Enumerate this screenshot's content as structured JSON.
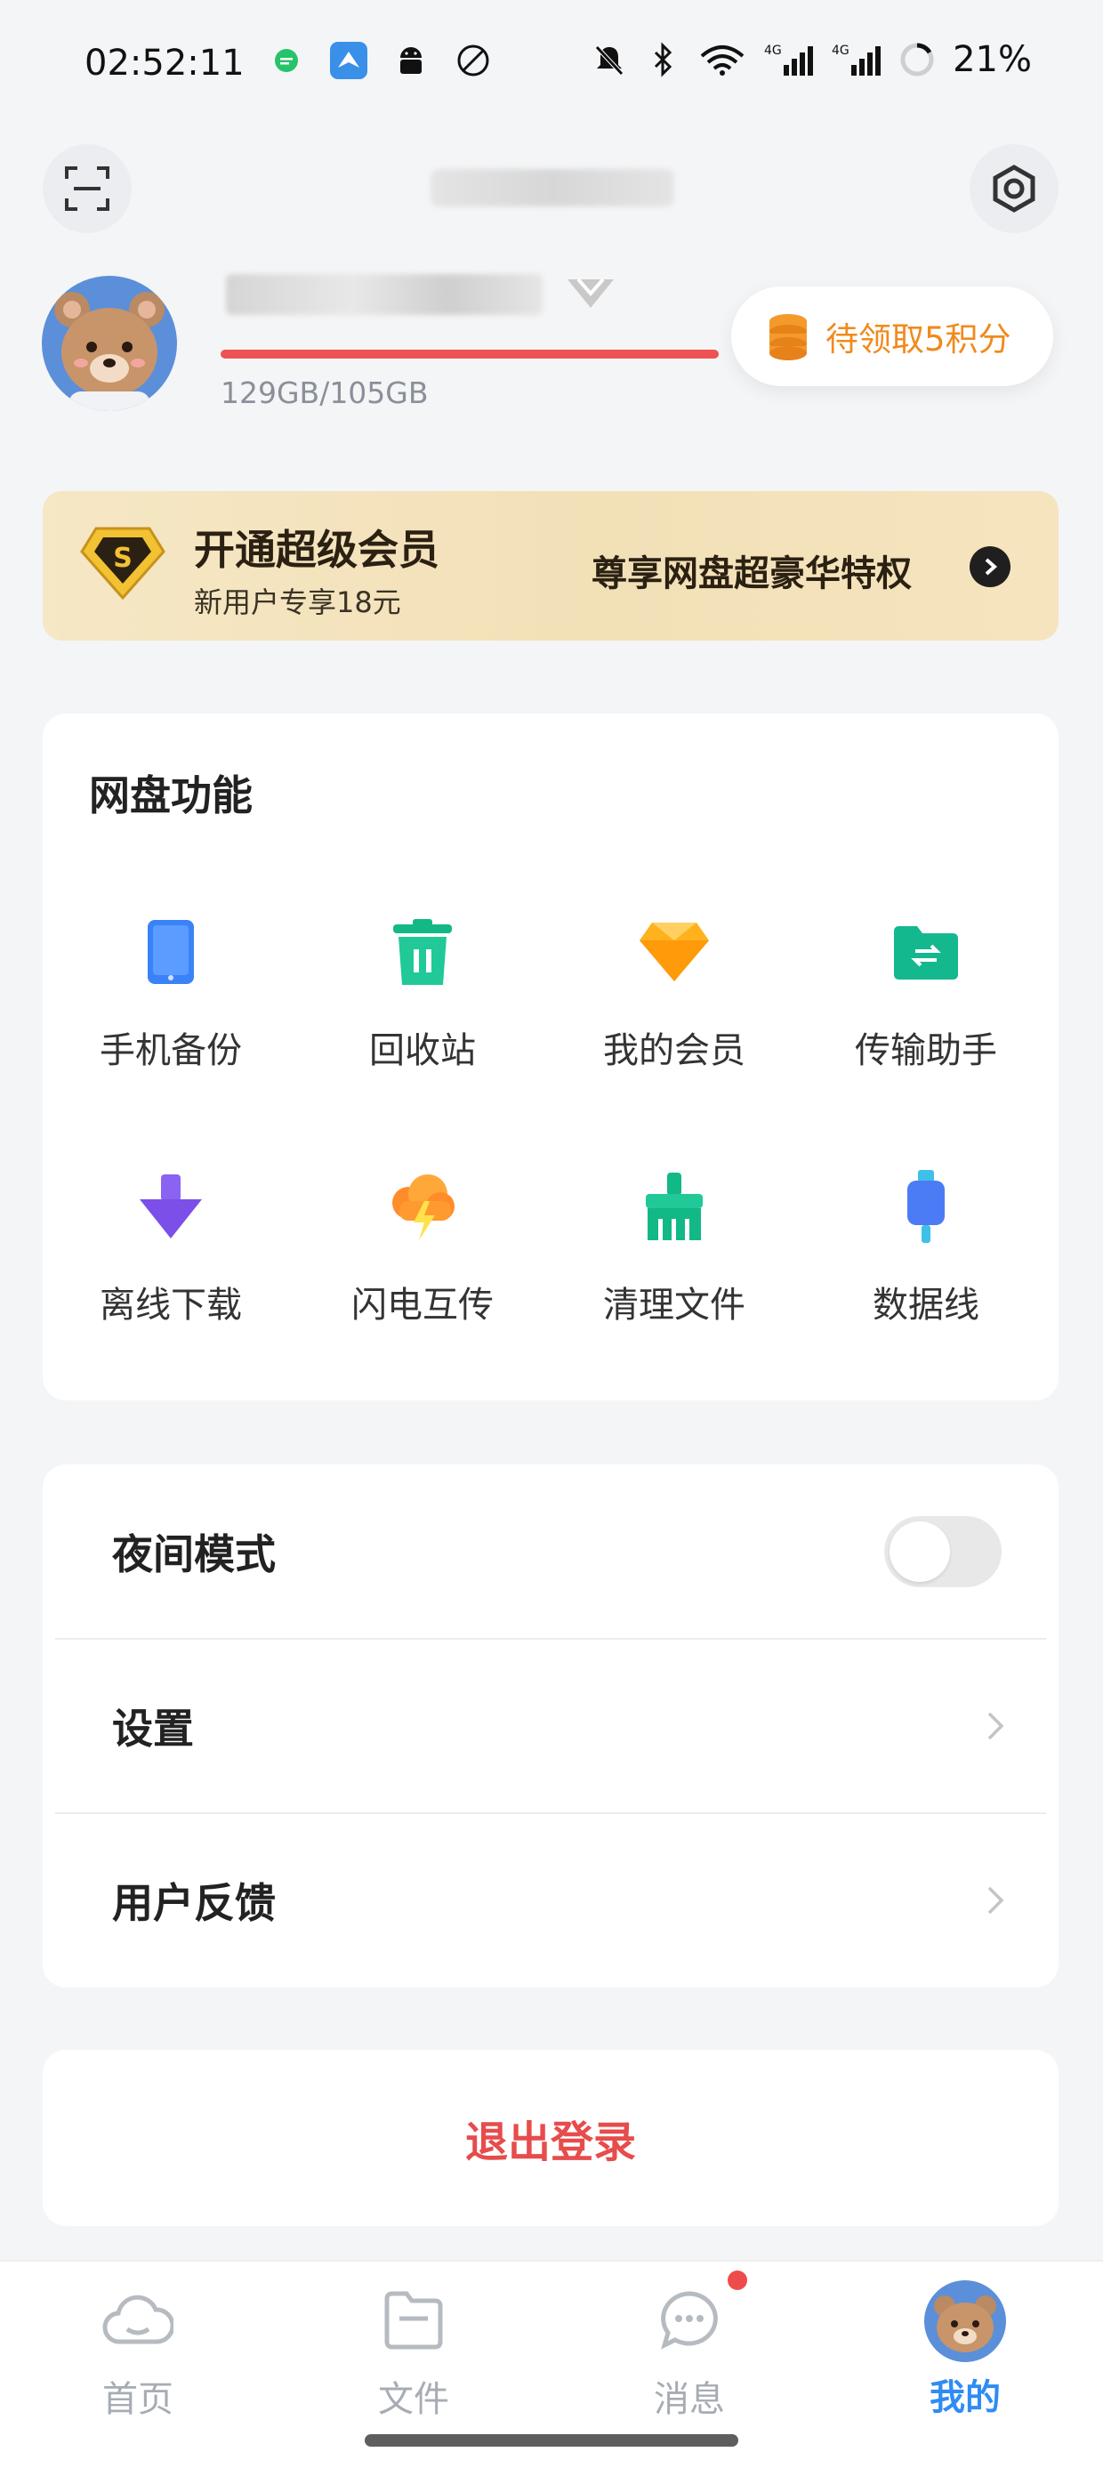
{
  "status_bar": {
    "time": "02:52:11",
    "battery": "21%",
    "icons": [
      "message-app-icon",
      "bird-app-icon",
      "android-icon",
      "no-signal-icon",
      "mute-icon",
      "bluetooth-icon",
      "wifi-icon",
      "4g-signal-icon",
      "4g-signal-icon",
      "battery-icon"
    ]
  },
  "profile": {
    "storage": "129GB/105GB",
    "points_chip": "待领取5积分"
  },
  "vip_banner": {
    "title": "开通超级会员",
    "subtitle": "新用户专享18元",
    "promo": "尊享网盘超豪华特权",
    "badge_letter": "S"
  },
  "features": {
    "title": "网盘功能",
    "items": [
      {
        "label": "手机备份",
        "icon": "phone-backup-icon"
      },
      {
        "label": "回收站",
        "icon": "trash-icon"
      },
      {
        "label": "我的会员",
        "icon": "diamond-icon"
      },
      {
        "label": "传输助手",
        "icon": "transfer-folder-icon"
      },
      {
        "label": "离线下载",
        "icon": "download-arrow-icon"
      },
      {
        "label": "闪电互传",
        "icon": "lightning-cloud-icon"
      },
      {
        "label": "清理文件",
        "icon": "broom-icon"
      },
      {
        "label": "数据线",
        "icon": "usb-cable-icon"
      }
    ]
  },
  "menu": {
    "night_mode": {
      "label": "夜间模式",
      "enabled": false
    },
    "settings": "设置",
    "feedback": "用户反馈"
  },
  "logout": "退出登录",
  "tabs": [
    {
      "label": "首页",
      "icon": "cloud-icon"
    },
    {
      "label": "文件",
      "icon": "folder-icon"
    },
    {
      "label": "消息",
      "icon": "chat-bubble-icon"
    },
    {
      "label": "我的",
      "icon": "avatar-icon",
      "active": true
    }
  ],
  "colors": {
    "accent": "#2f8cf2",
    "danger": "#e74c4c",
    "points": "#f08a1c",
    "vip_gold": "#f2e0b7"
  }
}
